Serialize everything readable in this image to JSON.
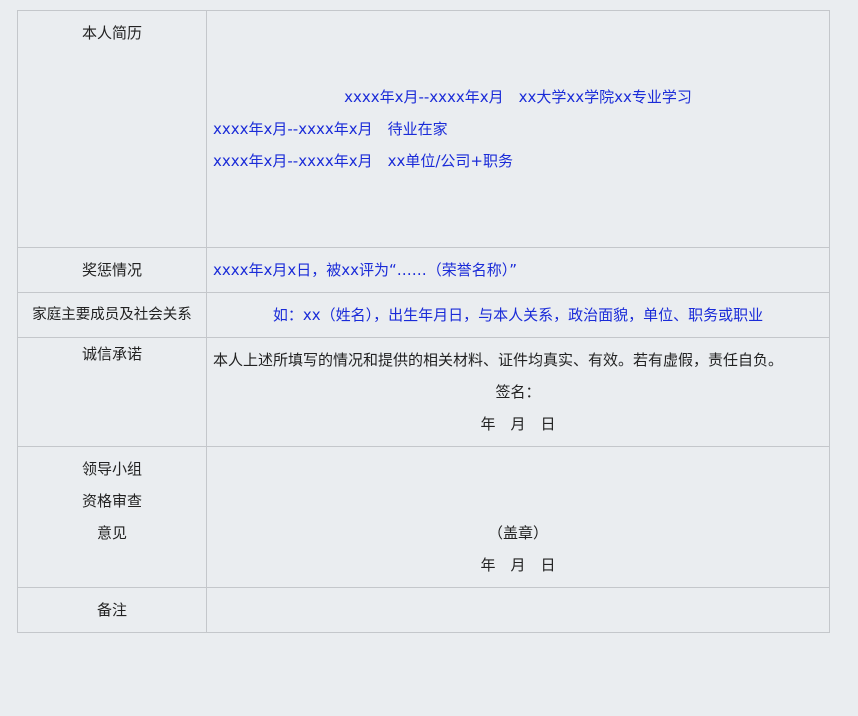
{
  "rows": {
    "resume": {
      "label": "本人简历",
      "lines": [
        "xxxx年x月--xxxx年x月　xx大学xx学院xx专业学习",
        "xxxx年x月--xxxx年x月　待业在家",
        "xxxx年x月--xxxx年x月　xx单位/公司+职务"
      ]
    },
    "awards": {
      "label": "奖惩情况",
      "text": "xxxx年x月x日，被xx评为“……（荣誉名称）”"
    },
    "family": {
      "label": "家庭主要成员及社会关系",
      "text": "如：xx（姓名），出生年月日，与本人关系，政治面貌，单位、职务或职业"
    },
    "integrity": {
      "label": "诚信承诺",
      "statement": "本人上述所填写的情况和提供的相关材料、证件均真实、有效。若有虚假，责任自负。",
      "signature": "签名：",
      "date": "年　月　日"
    },
    "review": {
      "label_lines": [
        "领导小组",
        "资格审查",
        "意见"
      ],
      "stamp": "（盖章）",
      "date": "年　月　日"
    },
    "remarks": {
      "label": "备注",
      "text": ""
    }
  }
}
